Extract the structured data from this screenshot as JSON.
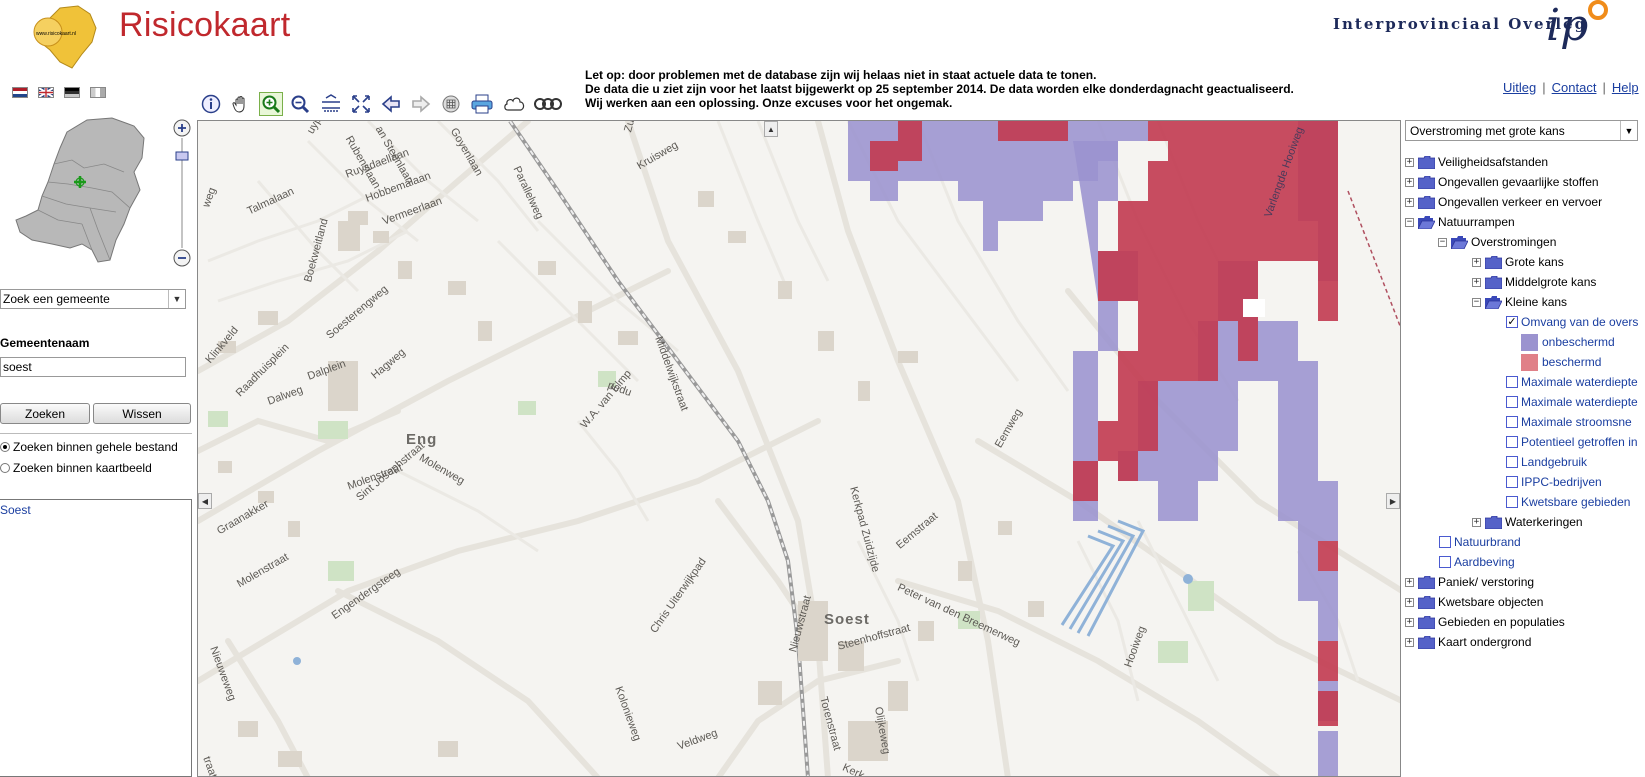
{
  "app": {
    "title": "Risicokaart",
    "logo_text": "www.risicokaart.nl",
    "org_name": "Interprovinciaal Overleg",
    "org_logo_text": "ipo"
  },
  "notice": {
    "line1": "Let op: door problemen met de database zijn wij helaas niet in staat actuele data te tonen.",
    "line2": "De data die u ziet zijn voor het laatst bijgewerkt op 25 september 2014. De data worden elke donderdagnacht geactualiseerd.",
    "line3": "Wij werken aan een oplossing. Onze excuses voor het ongemak."
  },
  "toplinks": {
    "uitleg": "Uitleg",
    "contact": "Contact",
    "help": "Help"
  },
  "search": {
    "select_value": "Zoek een gemeente",
    "label": "Gemeentenaam",
    "input_value": "soest",
    "search_button": "Zoeken",
    "clear_button": "Wissen",
    "radio_whole": "Zoeken binnen gehele bestand",
    "radio_map": "Zoeken binnen kaartbeeld",
    "result": "Soest"
  },
  "layers": {
    "select_value": "Overstroming met grote kans",
    "tree": {
      "veiligheidsafstanden": "Veiligheidsafstanden",
      "gevaarlijke_stoffen": "Ongevallen gevaarlijke stoffen",
      "verkeer": "Ongevallen verkeer en vervoer",
      "natuurrampen": "Natuurrampen",
      "overstromingen": "Overstromingen",
      "grote_kans": "Grote kans",
      "middelgrote_kans": "Middelgrote kans",
      "kleine_kans": "Kleine kans",
      "omvang": "Omvang van de overs",
      "onbeschermd": "onbeschermd",
      "beschermd": "beschermd",
      "max_waterdiepte1": "Maximale waterdiepte",
      "max_waterdiepte2": "Maximale waterdiepte",
      "max_stroomsnelheid": "Maximale stroomsne",
      "potentieel": "Potentieel getroffen in",
      "landgebruik": "Landgebruik",
      "ippc": "IPPC-bedrijven",
      "kwetsbare_gebieden": "Kwetsbare gebieden",
      "waterkeringen": "Waterkeringen",
      "natuurbrand": "Natuurbrand",
      "aardbeving": "Aardbeving",
      "paniek": "Paniek/ verstoring",
      "kwetsbare_objecten": "Kwetsbare objecten",
      "gebieden_populaties": "Gebieden en populaties",
      "kaart_ondergrond": "Kaart ondergrond"
    }
  },
  "map": {
    "place_labels": {
      "eng": "Eng",
      "soest": "Soest"
    },
    "street_labels": {
      "duyplan": "uyplan",
      "rubenslaan": "Rubenslaan",
      "steenlaan": "an Steenlaan",
      "goyenlaan": "Goyenlaan",
      "ruysdaellaan": "Ruysdaellaan",
      "hobbemalaan": "Hobbemalaan",
      "vermeerlaan": "Vermeerlaan",
      "talmalaan": "Talmalaan",
      "boekweitland": "Boekweitland",
      "soesterengweg": "Soesterengweg",
      "klinkveld": "Klinkveld",
      "raadhuisplein": "Raadhuisplein",
      "dalweg": "Dalweg",
      "dalplein": "Dalplein",
      "hagweg": "Hagweg",
      "molenstraat": "Molenstraat",
      "molenweg": "Molenweg",
      "sint_josephstraat": "Sint Josephstraat",
      "graanakker": "Graanakker",
      "molenstraat2": "Molenstraat",
      "nieuweweg": "Nieuweweg",
      "engendergsteeg": "Engendergsteeg",
      "parallelweg": "Parallelweg",
      "kruisweg": "Kruisweg",
      "zuidpad": "Zuidpad",
      "middelwijkstraat": "Middelwijkstraat",
      "van_eimp": "W.A. van Elmp",
      "pedu": "pedu",
      "chris_uiterwijkpad": "Chris Uiterwijkpad",
      "kolonieweg": "Kolonieweg",
      "veldweg": "Veldweg",
      "kerkpad_zuidzijde": "Kerkpad Zuidzijde",
      "eemstraat": "Eemstraat",
      "eemweg": "Eemweg",
      "peter_vd_breemerweg": "Peter van den Breemerweg",
      "hooiweg": "Hooiweg",
      "torenstraat": "Torenstraat",
      "oslikeweg": "Olijkeweg",
      "steenhoffstraat": "Steenhoffstraat",
      "nieuwstraat": "Nieuwstraat",
      "varlengde_hooiweg": "Varlengde Hooiweg",
      "kerk": "Kerk",
      "straat": "traat",
      "weg": "weg"
    }
  },
  "colors": {
    "title_red": "#c0282d",
    "flood_unprotected": "#9b93cf",
    "flood_protected": "#c23a50",
    "link_blue": "#1a3ea0"
  }
}
